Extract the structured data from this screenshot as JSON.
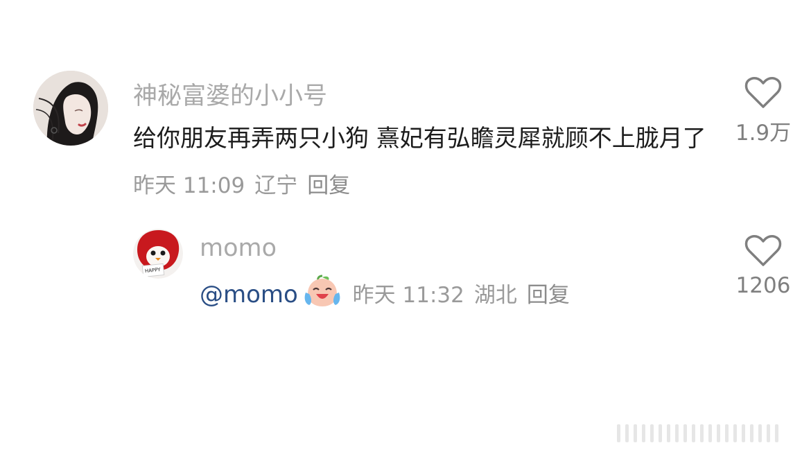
{
  "comments": [
    {
      "username": "神秘富婆的小小号",
      "text": "给你朋友再弄两只小狗 熹妃有弘瞻灵犀就顾不上胧月了",
      "time": "昨天 11:09",
      "location": "辽宁",
      "reply_label": "回复",
      "like_count": "1.9万",
      "avatar_icon": "woman-portrait-avatar"
    }
  ],
  "reply": {
    "username": "momo",
    "mention": "@momo",
    "emoji": "laughing-crying-peach-emoji",
    "time": "昨天 11:32",
    "location": "湖北",
    "reply_label": "回复",
    "like_count": "1206",
    "avatar_icon": "red-penguin-plush-avatar",
    "avatar_text": "HAPPY"
  },
  "colors": {
    "username": "#a9a9a9",
    "body_text": "#1c1c1c",
    "meta": "#9a9a9a",
    "mention": "#2a4e85",
    "heart_outline": "#7f7f7f"
  }
}
